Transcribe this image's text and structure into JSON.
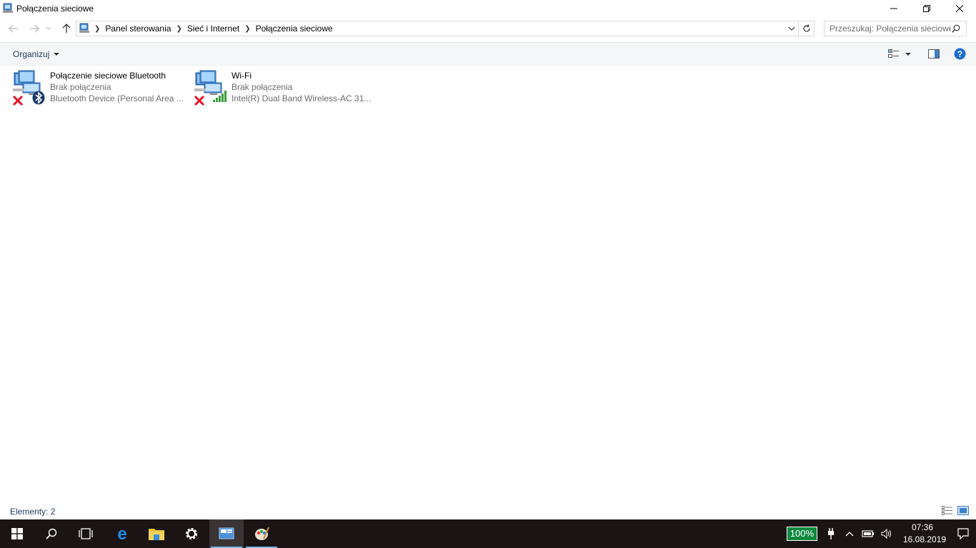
{
  "window": {
    "title": "Połączenia sieciowe"
  },
  "address": {
    "breadcrumbs": [
      "Panel sterowania",
      "Sieć i Internet",
      "Połączenia sieciowe"
    ],
    "search_placeholder": "Przeszukaj: Połączenia sieciowe"
  },
  "toolbar": {
    "organize_label": "Organizuj"
  },
  "items": [
    {
      "name": "Połączenie sieciowe Bluetooth",
      "status": "Brak połączenia",
      "device": "Bluetooth Device (Personal Area ..."
    },
    {
      "name": "Wi-Fi",
      "status": "Brak połączenia",
      "device": "Intel(R) Dual Band Wireless-AC 31..."
    }
  ],
  "statusbar": {
    "count_label": "Elementy: 2"
  },
  "taskbar": {
    "battery": "100%",
    "time": "07:36",
    "date": "16.08.2019"
  },
  "colors": {
    "accent": "#76b9ed",
    "link": "#1e395b",
    "taskbar_bg": "#1b1414",
    "battery_bg": "#10893e",
    "error_red": "#e81123"
  }
}
